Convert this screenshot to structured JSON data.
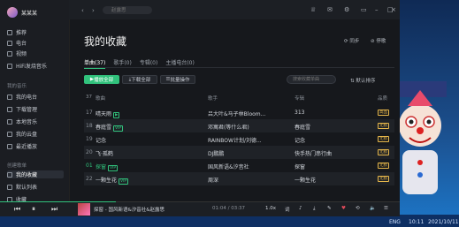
{
  "app": {
    "username": "某某某",
    "search_placeholder": "赵露思",
    "nav_back": "‹",
    "nav_forward": "›",
    "sections": [
      "我的音乐",
      "创建歌单"
    ],
    "nav_main": [
      "推荐",
      "电台",
      "视频",
      "HiFi发烧音乐"
    ],
    "nav_mine": [
      "我的电台",
      "下载管理",
      "本地音乐",
      "我的云盘",
      "最近播放"
    ],
    "nav_playlists": [
      "我的收藏",
      "默认列表",
      "收藏"
    ]
  },
  "page": {
    "title": "我的收藏",
    "sync_label": "同步",
    "hide_label": "停歌",
    "tabs": [
      "单曲(37)",
      "歌手(0)",
      "专辑(0)",
      "主播电台(0)"
    ],
    "play_all": "播放全部",
    "download_all": "下载全部",
    "batch": "批量操作",
    "search_in_list": "搜索收藏单曲",
    "sort_label": "默认排序"
  },
  "table": {
    "headers": [
      "37",
      "歌曲",
      "歌手",
      "专辑",
      "品质"
    ],
    "rows": [
      {
        "num": "17",
        "title": "晴天雨",
        "tag": "▶",
        "artist": "吕大叶&马子林Bloom...",
        "album": "313",
        "quality": "高品"
      },
      {
        "num": "18",
        "title": "春庭雪",
        "tag": "VIP",
        "artist": "邓寓君(等什么君)",
        "album": "春庭雪",
        "quality": "无损"
      },
      {
        "num": "19",
        "title": "记念",
        "tag": "",
        "artist": "RAINBOW计划/刘德...",
        "album": "记念",
        "quality": "无损"
      },
      {
        "num": "20",
        "title": "飞·孤鹤",
        "tag": "",
        "artist": "DJ鹏鹏",
        "album": "快手热门串行曲",
        "quality": "无损"
      },
      {
        "num": "01",
        "title": "探窗",
        "tag": "VIP",
        "artist": "国风新语&汐音社",
        "album": "探窗",
        "quality": "无损"
      },
      {
        "num": "22",
        "title": "一颗生花",
        "tag": "VIP",
        "artist": "周深",
        "album": "一颗生花",
        "quality": "无损"
      }
    ]
  },
  "player": {
    "now_playing": "探窗 - 国风新语&汐音社&赵露思",
    "time": "01:04 / 03:37",
    "speed": "1.0x",
    "progress": 0.29
  },
  "desktop": {
    "taskbar_time": "10:11",
    "taskbar_date": "2021/10/11",
    "taskbar_lang": "ENG"
  },
  "colors": {
    "accent": "#31c27c",
    "quality_gold": "#e7b84b"
  }
}
